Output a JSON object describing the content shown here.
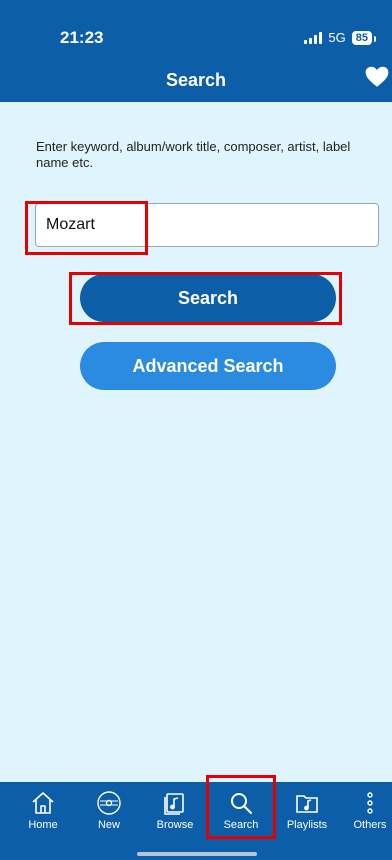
{
  "status_bar": {
    "time": "21:23",
    "network": "5G",
    "battery": "85"
  },
  "header": {
    "title": "Search"
  },
  "search": {
    "instruction": "Enter keyword, album/work title, composer, artist, label name etc.",
    "value": "Mozart",
    "search_label": "Search",
    "advanced_label": "Advanced Search"
  },
  "tabs": [
    {
      "label": "Home",
      "icon": "home-icon"
    },
    {
      "label": "New",
      "icon": "new-icon"
    },
    {
      "label": "Browse",
      "icon": "browse-icon"
    },
    {
      "label": "Search",
      "icon": "search-icon"
    },
    {
      "label": "Playlists",
      "icon": "playlists-icon"
    },
    {
      "label": "Others",
      "icon": "more-icon"
    }
  ],
  "colors": {
    "primary": "#0d5ea8",
    "secondary_button": "#2b8be0",
    "background": "#dff4fd",
    "highlight": "#e60000"
  }
}
